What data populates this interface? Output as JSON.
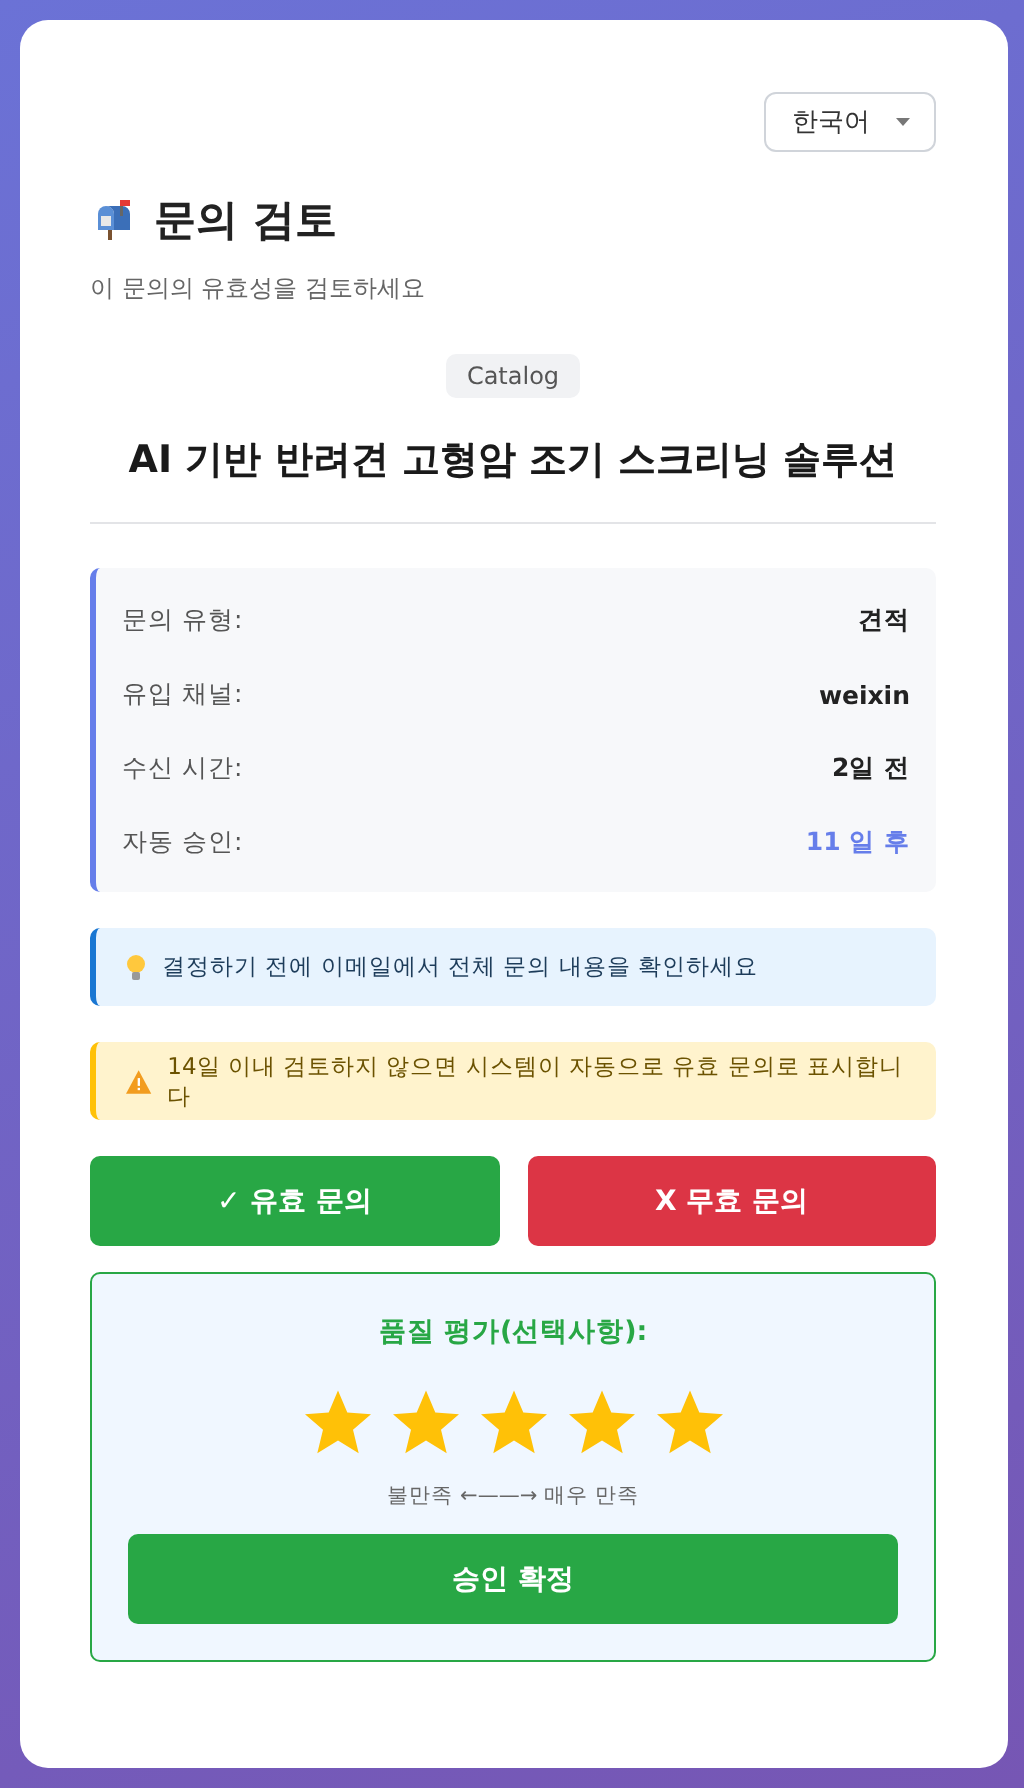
{
  "language_select": {
    "value": "한국어"
  },
  "header": {
    "title": "문의 검토",
    "subtitle": "이 문의의 유효성을 검토하세요"
  },
  "category_badge": "Catalog",
  "product_title": "AI 기반 반려견 고형암 조기 스크리닝 솔루션",
  "details": [
    {
      "label": "문의 유형:",
      "value": "견적",
      "kind": "plain"
    },
    {
      "label": "유입 채널:",
      "value": "weixin",
      "kind": "plain"
    },
    {
      "label": "수신 시간:",
      "value": "2일 전",
      "kind": "plain"
    },
    {
      "label": "자동 승인:",
      "value": "11 일 후",
      "kind": "highlight"
    }
  ],
  "alerts": [
    {
      "kind": "info",
      "text": "결정하기 전에 이메일에서 전체 문의 내용을 확인하세요"
    },
    {
      "kind": "warning",
      "text": "14일 이내 검토하지 않으면 시스템이 자동으로 유효 문의로 표시합니다"
    }
  ],
  "actions": [
    {
      "kind": "valid",
      "label": "✓ 유효 문의"
    },
    {
      "kind": "invalid",
      "label": "X 무효 문의"
    }
  ],
  "rating": {
    "title": "품질 평가(선택사항):",
    "stars": 5,
    "scale_hint": "불만족 ←——→ 매우 만족",
    "confirm_label": "승인 확정"
  }
}
